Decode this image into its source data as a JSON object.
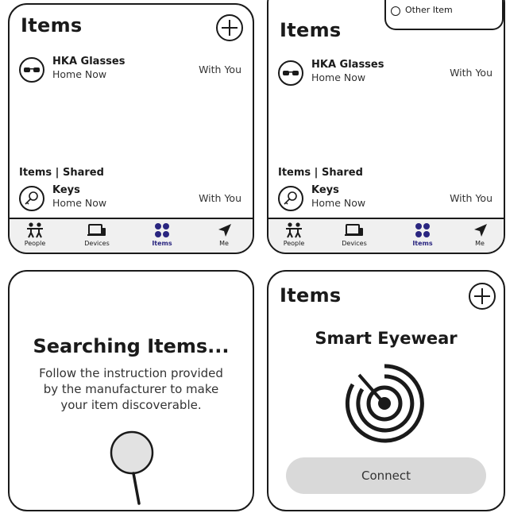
{
  "panel1": {
    "title": "Items",
    "items": [
      {
        "name": "HKA Glasses",
        "sub": "Home  Now",
        "status": "With You",
        "icon": "sunglasses-icon"
      }
    ],
    "shared_label": "Items | Shared",
    "shared_items": [
      {
        "name": "Keys",
        "sub": "Home  Now",
        "status": "With You",
        "icon": "key-icon"
      }
    ],
    "tabs": [
      {
        "label": "People",
        "icon": "people-icon"
      },
      {
        "label": "Devices",
        "icon": "devices-icon"
      },
      {
        "label": "Items",
        "icon": "items-grid-icon",
        "active": true
      },
      {
        "label": "Me",
        "icon": "location-arrow-icon"
      }
    ]
  },
  "panel2": {
    "title": "Items",
    "popup_option": "Other Item",
    "items": [
      {
        "name": "HKA Glasses",
        "sub": "Home  Now",
        "status": "With You",
        "icon": "sunglasses-icon"
      }
    ],
    "shared_label": "Items | Shared",
    "shared_items": [
      {
        "name": "Keys",
        "sub": "Home  Now",
        "status": "With You",
        "icon": "key-icon"
      }
    ],
    "tabs": [
      {
        "label": "People",
        "icon": "people-icon"
      },
      {
        "label": "Devices",
        "icon": "devices-icon"
      },
      {
        "label": "Items",
        "icon": "items-grid-icon",
        "active": true
      },
      {
        "label": "Me",
        "icon": "location-arrow-icon"
      }
    ]
  },
  "panel3": {
    "heading": "Searching Items...",
    "description": "Follow the instruction provided by the manufacturer to make your item discoverable.",
    "icon": "magnifier-icon"
  },
  "panel4": {
    "title": "Items",
    "device_name": "Smart Eyewear",
    "icon": "radar-icon",
    "connect_label": "Connect"
  },
  "colors": {
    "accent": "#2a2680",
    "tabbar_bg": "#f0f0f0",
    "button_bg": "#d9d9d9",
    "border": "#1a1a1a"
  }
}
